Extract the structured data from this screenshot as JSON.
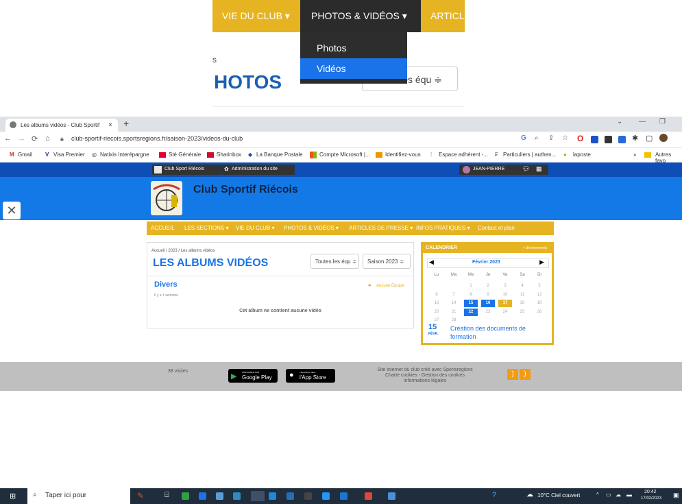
{
  "zoom": {
    "nav": [
      "VIE DU CLUB ▾",
      "PHOTOS & VIDÉOS ▾",
      "ARTICL"
    ],
    "menu": [
      "Photos",
      "Vidéos"
    ],
    "heading": "HOTOS",
    "small": "s",
    "select": "Toutes les équ ≑"
  },
  "browser": {
    "tab_title": "Les albums vidéos - Club Sportif",
    "url": "club-sportif-riecois.sportsregions.fr/saison-2023/videos-du-club",
    "bookmarks": [
      "Gmail",
      "Visa Premier",
      "Natixis Interépargne",
      "Sté Générale",
      "Sharinbox",
      "La Banque Postale",
      "Compte Microsoft |...",
      "Identifiez-vous",
      "Espace adhérent -...",
      "Particuliers | authen...",
      "laposte"
    ],
    "other_bookmarks": "Autres favo"
  },
  "adminbar": {
    "club": "Club Sport Riécois",
    "admin": "Administration du site",
    "user": "JEAN-PIERRE"
  },
  "site": {
    "title": "Club Sportif Riécois",
    "nav": [
      "ACCUEIL",
      "LES SECTIONS ▾",
      "VIE DU CLUB ▾",
      "PHOTOS & VIDÉOS ▾",
      "ARTICLES DE PRESSE ▾",
      "INFOS PRATIQUES ▾",
      "Contact et plan"
    ],
    "breadcrumb": "Accueil / 2023 / Les albums vidéos",
    "page_title": "LES ALBUMS VIDÉOS",
    "filter_team": "Toutes les équ ≑",
    "filter_season": "Saison 2023 ≑",
    "album_title": "Divers",
    "album_date": "Il y a 1 semaine",
    "album_team": "Aucune Equipe",
    "empty": "Cet album ne contient aucune vidéo"
  },
  "calendar": {
    "title": "CALENDRIER",
    "more": "+ d'événements",
    "month": "Février 2023",
    "days": [
      "Lu",
      "Ma",
      "Me",
      "Je",
      "Ve",
      "Sa",
      "Di"
    ],
    "weeks": [
      [
        "",
        "",
        "1",
        "2",
        "3",
        "4",
        "5"
      ],
      [
        "6",
        "7",
        "8",
        "9",
        "10",
        "11",
        "12"
      ],
      [
        "13",
        "14",
        "15",
        "16",
        "17",
        "18",
        "19"
      ],
      [
        "20",
        "21",
        "22",
        "23",
        "24",
        "25",
        "26"
      ],
      [
        "27",
        "28",
        "",
        "",
        "",
        "",
        ""
      ]
    ],
    "event_day": "15",
    "event_month": "FÉVR.",
    "event_title": "Création des documents de formation"
  },
  "footer": {
    "visits": "38 visites",
    "gp_small": "DISPONIBLE SUR",
    "gp_big": "Google Play",
    "as_small": "Télécharger dans",
    "as_big": "l'App Store",
    "info1": "Site internet du club créé avec Sportsregions",
    "info2": "Charte cookies - Gestion des cookies",
    "info3": "Informations légales"
  },
  "taskbar": {
    "search": "Taper ici pour",
    "weather": "10°C  Ciel couvert",
    "time": "20:42",
    "date": "17/02/2023"
  }
}
